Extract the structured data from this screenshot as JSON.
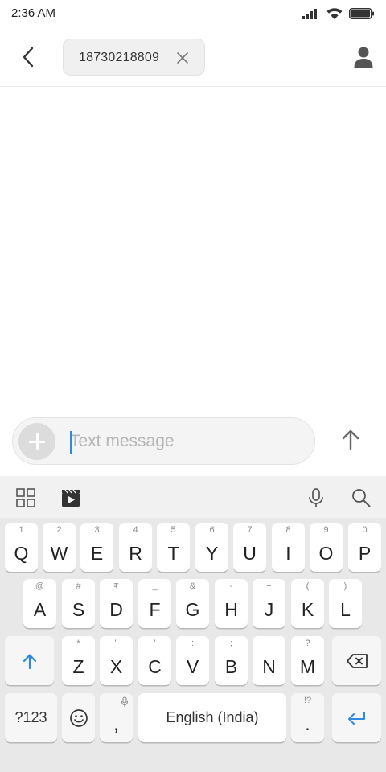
{
  "status_bar": {
    "time": "2:36 AM",
    "icons": [
      "signal-icon",
      "wifi-icon",
      "battery-icon"
    ]
  },
  "header": {
    "back_icon": "chevron-left-icon",
    "recipient": "18730218809",
    "remove_icon": "close-icon",
    "contact_icon": "person-icon"
  },
  "compose": {
    "placeholder": "Text message",
    "value": "",
    "add_icon": "plus-icon",
    "send_icon": "arrow-up-icon"
  },
  "keyboard_toolbar": {
    "items": [
      "grid-icon",
      "clapperboard-icon",
      "microphone-icon",
      "search-icon"
    ]
  },
  "keyboard": {
    "row1": [
      {
        "key": "Q",
        "hint": "1"
      },
      {
        "key": "W",
        "hint": "2"
      },
      {
        "key": "E",
        "hint": "3"
      },
      {
        "key": "R",
        "hint": "4"
      },
      {
        "key": "T",
        "hint": "5"
      },
      {
        "key": "Y",
        "hint": "6"
      },
      {
        "key": "U",
        "hint": "7"
      },
      {
        "key": "I",
        "hint": "8"
      },
      {
        "key": "O",
        "hint": "9"
      },
      {
        "key": "P",
        "hint": "0"
      }
    ],
    "row2": [
      {
        "key": "A",
        "hint": "@"
      },
      {
        "key": "S",
        "hint": "#"
      },
      {
        "key": "D",
        "hint": "₹"
      },
      {
        "key": "F",
        "hint": "_"
      },
      {
        "key": "G",
        "hint": "&"
      },
      {
        "key": "H",
        "hint": "-"
      },
      {
        "key": "J",
        "hint": "+"
      },
      {
        "key": "K",
        "hint": "("
      },
      {
        "key": "L",
        "hint": ")"
      }
    ],
    "row3": [
      {
        "key": "Z",
        "hint": "*"
      },
      {
        "key": "X",
        "hint": "\""
      },
      {
        "key": "C",
        "hint": "'"
      },
      {
        "key": "V",
        "hint": ":"
      },
      {
        "key": "B",
        "hint": ";"
      },
      {
        "key": "N",
        "hint": "!"
      },
      {
        "key": "M",
        "hint": "?"
      }
    ],
    "shift_icon": "shift-arrow-icon",
    "backspace_icon": "backspace-icon",
    "symbols_label": "?123",
    "emoji_icon": "smiley-icon",
    "comma": ",",
    "space_label": "English (India)",
    "period": ".",
    "period_hint": "!?",
    "enter_icon": "enter-icon",
    "accent_color": "#2d8ae0"
  }
}
